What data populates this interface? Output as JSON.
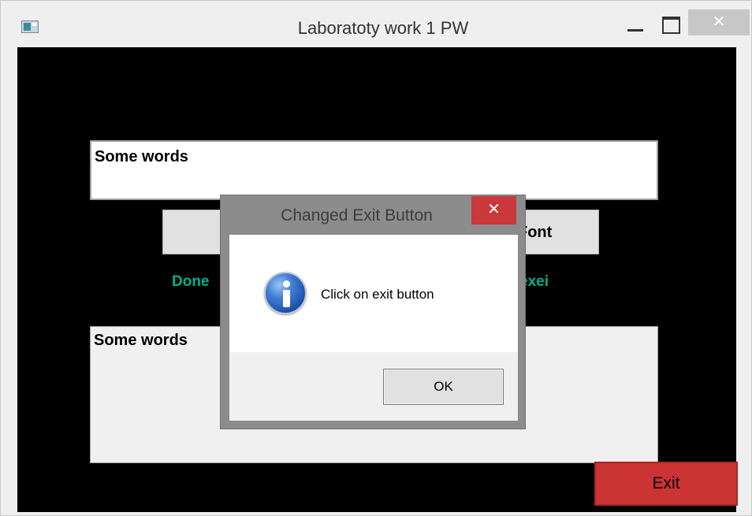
{
  "window": {
    "title": "Laboratoty work 1 PW",
    "icon": "app-icon",
    "controls": {
      "minimize": "minimize-icon",
      "maximize": "maximize-icon",
      "close_label": "✕"
    }
  },
  "main": {
    "edit_top_text": "Some words",
    "font_button_label": "Font",
    "status_left": "Done",
    "status_right": "Alexei",
    "edit_bottom_text": "Some words",
    "exit_button_label": "Exit"
  },
  "dialog": {
    "title": "Changed Exit Button",
    "close_label": "✕",
    "icon": "info-icon",
    "message": "Click on exit button",
    "ok_label": "OK"
  },
  "colors": {
    "client_bg": "#000000",
    "status_text": "#00b08a",
    "exit_button": "#cc3333",
    "dialog_close": "#c9383a"
  }
}
